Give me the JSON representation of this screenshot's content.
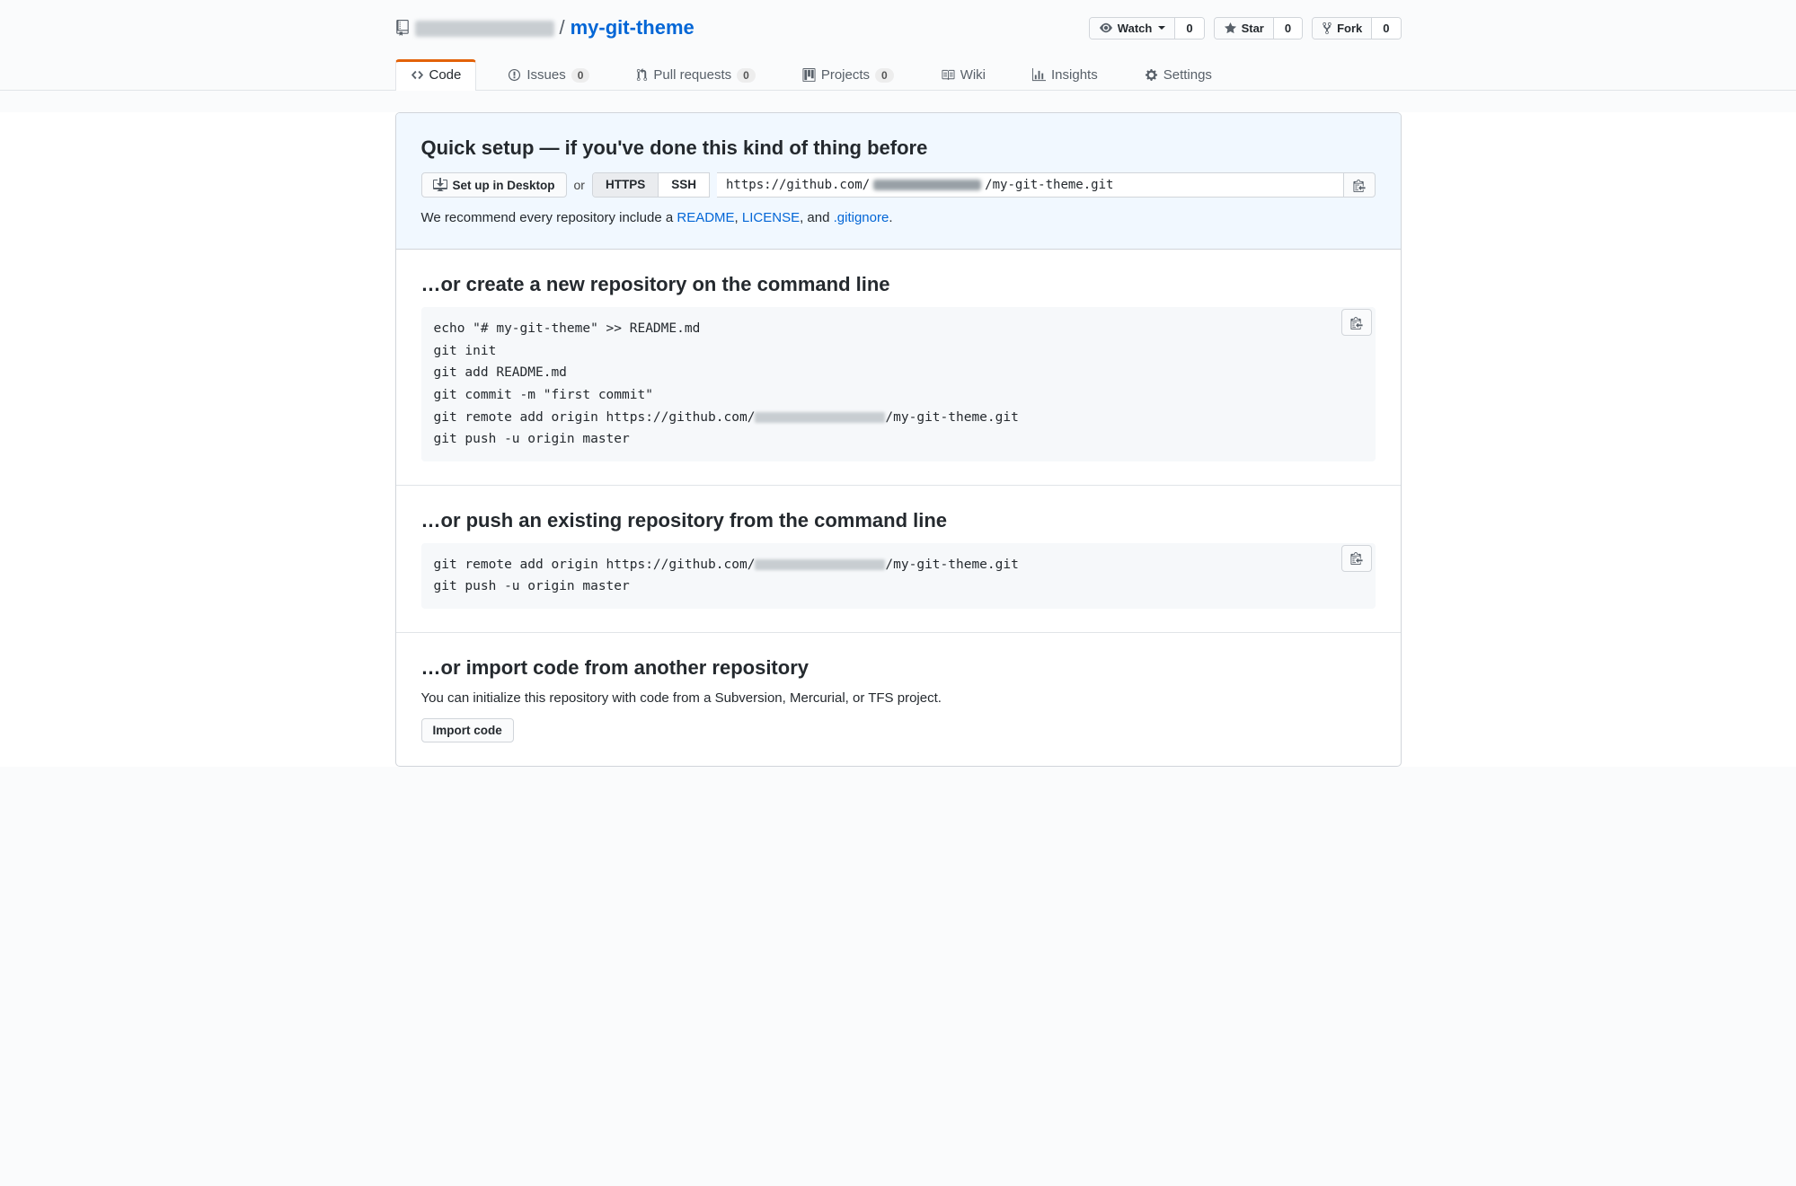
{
  "repo": {
    "owner_redacted": true,
    "name": "my-git-theme",
    "separator": "/"
  },
  "actions": {
    "watch": {
      "label": "Watch",
      "count": "0"
    },
    "star": {
      "label": "Star",
      "count": "0"
    },
    "fork": {
      "label": "Fork",
      "count": "0"
    }
  },
  "tabs": {
    "code": "Code",
    "issues": {
      "label": "Issues",
      "count": "0"
    },
    "pull_requests": {
      "label": "Pull requests",
      "count": "0"
    },
    "projects": {
      "label": "Projects",
      "count": "0"
    },
    "wiki": "Wiki",
    "insights": "Insights",
    "settings": "Settings"
  },
  "quick_setup": {
    "heading": "Quick setup — if you've done this kind of thing before",
    "desktop_button": "Set up in Desktop",
    "or": "or",
    "proto_https": "HTTPS",
    "proto_ssh": "SSH",
    "clone_url_prefix": "https://github.com/",
    "clone_url_suffix": "/my-git-theme.git",
    "recommend_prefix": "We recommend every repository include a ",
    "readme": "README",
    "license": "LICENSE",
    "gitignore": ".gitignore",
    "comma": ", ",
    "and": ", and ",
    "period": "."
  },
  "create_new": {
    "heading": "…or create a new repository on the command line",
    "line1": "echo \"# my-git-theme\" >> README.md",
    "line2": "git init",
    "line3": "git add README.md",
    "line4": "git commit -m \"first commit\"",
    "line5_prefix": "git remote add origin https://github.com/",
    "line5_suffix": "/my-git-theme.git",
    "line6": "git push -u origin master"
  },
  "push_existing": {
    "heading": "…or push an existing repository from the command line",
    "line1_prefix": "git remote add origin https://github.com/",
    "line1_suffix": "/my-git-theme.git",
    "line2": "git push -u origin master"
  },
  "import": {
    "heading": "…or import code from another repository",
    "description": "You can initialize this repository with code from a Subversion, Mercurial, or TFS project.",
    "button": "Import code"
  }
}
